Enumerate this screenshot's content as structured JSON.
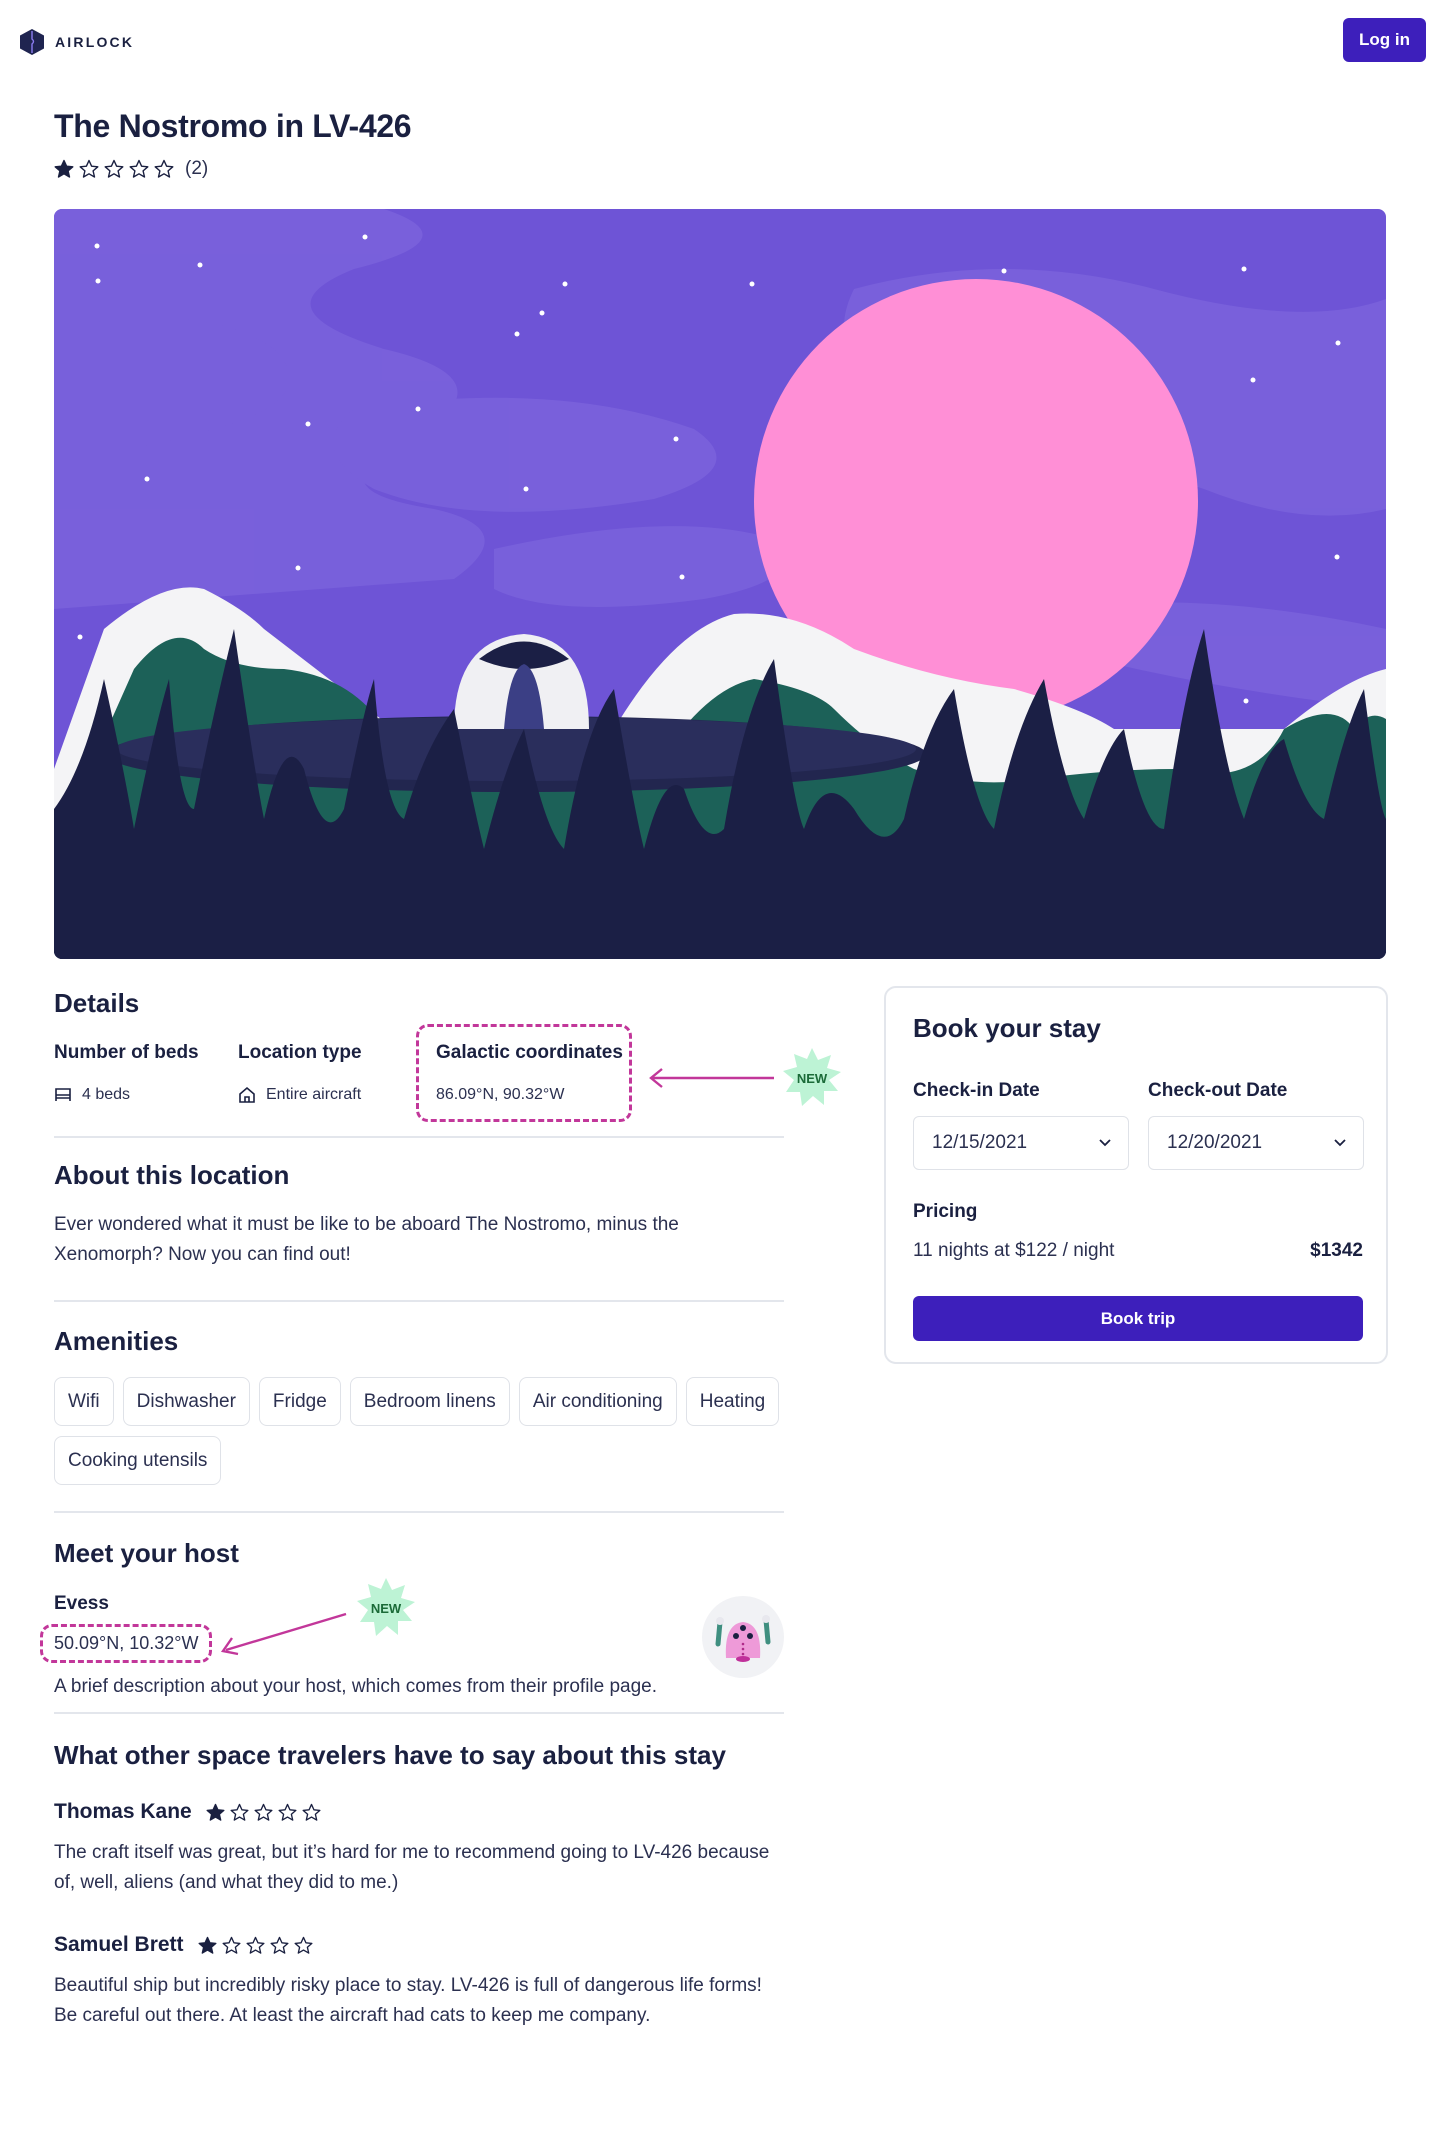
{
  "header": {
    "brand": "AIRLOCK",
    "login_label": "Log in"
  },
  "listing": {
    "title": "The Nostromo in LV-426",
    "rating": 1,
    "rating_max": 5,
    "review_count": "(2)"
  },
  "details": {
    "title": "Details",
    "beds_label": "Number of beds",
    "beds_value": "4 beds",
    "location_type_label": "Location type",
    "location_type_value": "Entire aircraft",
    "coords_label": "Galactic coordinates",
    "coords_value": "86.09°N, 90.32°W",
    "new_badge": "NEW"
  },
  "about": {
    "title": "About this location",
    "text": "Ever wondered what it must be like to be aboard The Nostromo, minus the Xenomorph? Now you can find out!"
  },
  "amenities": {
    "title": "Amenities",
    "items": [
      "Wifi",
      "Dishwasher",
      "Fridge",
      "Bedroom linens",
      "Air conditioning",
      "Heating",
      "Cooking utensils"
    ]
  },
  "host": {
    "title": "Meet your host",
    "name": "Evess",
    "coords": "50.09°N, 10.32°W",
    "description": "A brief description about your host, which comes from their profile page.",
    "new_badge": "NEW"
  },
  "reviews": {
    "title": "What other space travelers have to say about this stay",
    "items": [
      {
        "name": "Thomas Kane",
        "rating": 1,
        "text": "The craft itself was great, but it’s hard for me to recommend going to LV-426 because of, well, aliens (and what they did to me.)"
      },
      {
        "name": "Samuel Brett",
        "rating": 1,
        "text": "Beautiful ship but incredibly risky place to stay. LV-426 is full of dangerous life forms! Be careful out there. At least the aircraft had cats to keep me company."
      }
    ]
  },
  "booking": {
    "title": "Book your stay",
    "checkin_label": "Check-in Date",
    "checkin_value": "12/15/2021",
    "checkout_label": "Check-out Date",
    "checkout_value": "12/20/2021",
    "pricing_label": "Pricing",
    "pricing_summary": "11 nights at $122 / night",
    "pricing_total": "$1342",
    "book_label": "Book trip"
  },
  "colors": {
    "primary": "#3d1fbb",
    "text": "#1a2040",
    "annotation": "#c2379a",
    "badge_bg": "#bdf3d5",
    "badge_text": "#1b6b38",
    "sky": "#6e54d6",
    "planet": "#ff8fd6",
    "hills": "#1c6158",
    "trees": "#1b1f45"
  }
}
